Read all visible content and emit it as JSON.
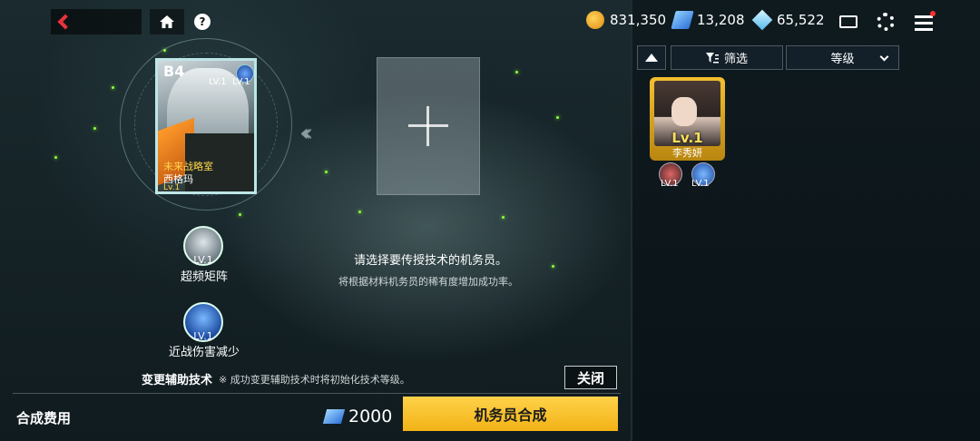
{
  "topbar": {
    "currencies": [
      {
        "icon": "gold-coin-icon",
        "value": "831,350"
      },
      {
        "icon": "ticket-icon",
        "value": "13,208"
      },
      {
        "icon": "diamond-icon",
        "value": "65,522"
      }
    ],
    "help_label": "?"
  },
  "card": {
    "grade": "B4",
    "lv_left": "LV.1",
    "lv_right": "LV.1",
    "team": "未来战略室",
    "name": "西格玛",
    "level": "Lv.1"
  },
  "skills": [
    {
      "lv": "LV.1",
      "label": "超频矩阵"
    },
    {
      "lv": "LV.1",
      "label": "近战伤害减少"
    }
  ],
  "message": {
    "line1": "请选择要传授技术的机务员。",
    "line2": "将根据材料机务员的稀有度增加成功率。"
  },
  "footer": {
    "change_label": "变更辅助技术",
    "change_note": "※ 成功变更辅助技术时将初始化技术等级。",
    "close_label": "关闭",
    "cost_label": "合成费用",
    "cost_value": "2000",
    "synth_label": "机务员合成"
  },
  "panel": {
    "filter_label": "筛选",
    "sort_label": "等级",
    "units": [
      {
        "level": "Lv.1",
        "name": "李秀妍",
        "skill_lv_1": "LV.1",
        "skill_lv_2": "LV.1"
      }
    ]
  },
  "colors": {
    "accent": "#f2b316",
    "back": "#e8323a",
    "particle": "#8aff3a"
  }
}
